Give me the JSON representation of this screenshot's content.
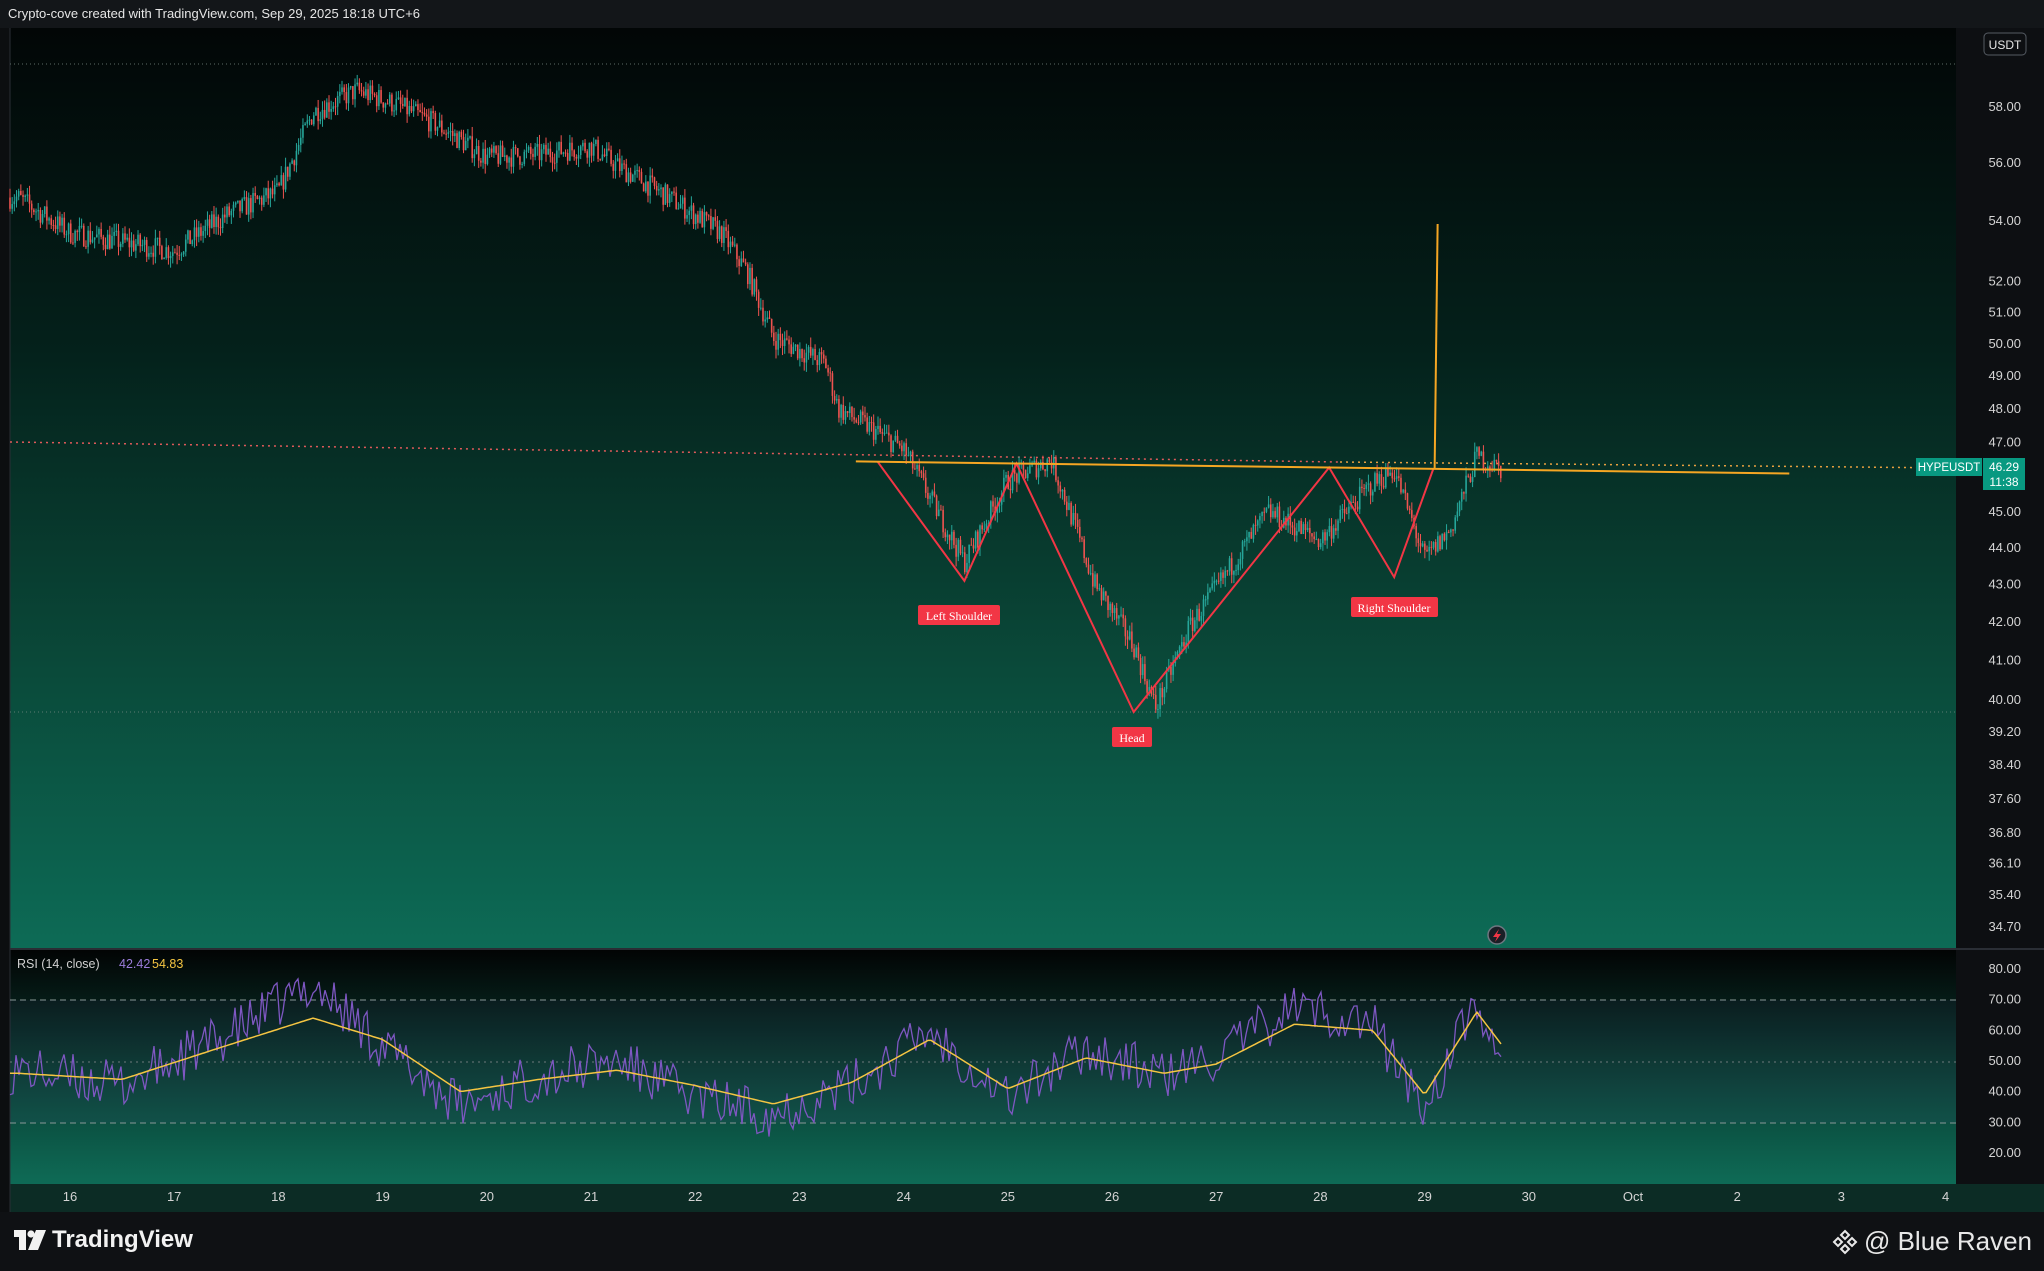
{
  "header": {
    "caption": "Crypto-cove created with TradingView.com, Sep 29, 2025 18:18 UTC+6"
  },
  "price_pane": {
    "currency_badge": "USDT",
    "y_ticks": [
      "58.00",
      "56.00",
      "54.00",
      "52.00",
      "51.00",
      "50.00",
      "49.00",
      "48.00",
      "47.00",
      "45.00",
      "44.00",
      "43.00",
      "42.00",
      "41.00",
      "40.00",
      "39.20",
      "38.40",
      "37.60",
      "36.80",
      "36.10",
      "35.40",
      "34.70"
    ],
    "symbol_label": "HYPEUSDT",
    "last_price": "46.29",
    "countdown": "11:38"
  },
  "annotations": {
    "left_shoulder": "Left Shoulder",
    "head": "Head",
    "right_shoulder": "Right Shoulder"
  },
  "rsi_pane": {
    "legend_name": "RSI (14, close)",
    "rsi_value": "42.42",
    "ma_value": "54.83",
    "y_ticks": [
      "80.00",
      "70.00",
      "60.00",
      "50.00",
      "40.00",
      "30.00",
      "20.00"
    ]
  },
  "x_axis": {
    "ticks": [
      "16",
      "17",
      "18",
      "19",
      "20",
      "21",
      "22",
      "23",
      "24",
      "25",
      "26",
      "27",
      "28",
      "29",
      "30",
      "Oct",
      "2",
      "3",
      "4"
    ]
  },
  "footer": {
    "brand": "TradingView",
    "watermark": "@ Blue Raven"
  },
  "colors": {
    "up": "#26a69a",
    "down": "#ef5350",
    "pattern": "#f23645",
    "neckline": "#f5a623",
    "rsi": "#7e57c2",
    "rsi_ma": "#f5c542",
    "price_badge": "#089981"
  },
  "chart_data": {
    "type": "candlestick",
    "title": "HYPEUSDT",
    "y_unit": "USDT",
    "price_path": {
      "x": [
        "Sep 15 12:00",
        "Sep 16 00:00",
        "Sep 17 00:00",
        "Sep 17 12:00",
        "Sep 18 00:00",
        "Sep 18 08:00",
        "Sep 18 18:00",
        "Sep 19 03:00",
        "Sep 19 12:00",
        "Sep 20 00:00",
        "Sep 20 12:00",
        "Sep 21 00:00",
        "Sep 21 06:00",
        "Sep 21 18:00",
        "Sep 22 06:00",
        "Sep 22 12:00",
        "Sep 22 18:00",
        "Sep 23 06:00",
        "Sep 23 09:00",
        "Sep 23 18:00",
        "Sep 24 00:00",
        "Sep 24 14:00",
        "Sep 25 00:00",
        "Sep 25 10:00",
        "Sep 25 20:00",
        "Sep 26 05:00",
        "Sep 26 10:00",
        "Sep 26 18:00",
        "Sep 27 00:00",
        "Sep 27 12:00",
        "Sep 28 00:00",
        "Sep 28 12:00",
        "Sep 28 17:00",
        "Sep 29 00:00",
        "Sep 29 06:00",
        "Sep 29 12:00",
        "Sep 29 18:00"
      ],
      "close": [
        54.8,
        53.6,
        53.0,
        54.2,
        55.0,
        57.8,
        58.6,
        58.1,
        57.4,
        56.2,
        56.3,
        56.6,
        55.9,
        54.8,
        53.6,
        52.3,
        50.2,
        49.4,
        48.0,
        47.3,
        46.8,
        43.6,
        45.9,
        46.5,
        43.0,
        41.4,
        39.8,
        41.9,
        42.9,
        45.0,
        44.2,
        45.8,
        46.2,
        43.7,
        44.5,
        46.6,
        46.2
      ]
    },
    "patterns": {
      "left_shoulder": {
        "x": "Sep 24 14:00",
        "low": 43.1
      },
      "head": {
        "x": "Sep 26 05:00",
        "low": 39.7
      },
      "right_shoulder": {
        "x": "Sep 28 17:00",
        "low": 43.2
      },
      "neckline": {
        "x1": "Sep 23 13:00",
        "y1": 46.45,
        "x2": "Oct 2 12:00",
        "y2": 46.1
      },
      "target_spike": {
        "x": "Sep 29 03:00",
        "high": 53.9
      }
    },
    "rsi": {
      "x": [
        "Sep 15 12:00",
        "Sep 16 12:00",
        "Sep 17 12:00",
        "Sep 18 08:00",
        "Sep 19 00:00",
        "Sep 19 18:00",
        "Sep 20 12:00",
        "Sep 21 06:00",
        "Sep 22 00:00",
        "Sep 22 18:00",
        "Sep 23 12:00",
        "Sep 24 06:00",
        "Sep 25 00:00",
        "Sep 25 18:00",
        "Sep 26 12:00",
        "Sep 27 00:00",
        "Sep 27 18:00",
        "Sep 28 12:00",
        "Sep 29 00:00",
        "Sep 29 12:00",
        "Sep 29 18:00"
      ],
      "rsi_values": [
        47,
        42,
        58,
        75,
        55,
        35,
        45,
        50,
        38,
        33,
        42,
        60,
        38,
        54,
        45,
        51,
        68,
        62,
        34,
        70,
        42.42
      ],
      "ma_values": [
        46,
        44,
        55,
        64,
        57,
        40,
        44,
        47,
        42,
        36,
        43,
        57,
        41,
        51,
        46,
        49,
        62,
        60,
        39,
        66,
        54.83
      ],
      "levels": [
        70,
        50,
        30
      ],
      "ylim": [
        17,
        82
      ]
    }
  }
}
